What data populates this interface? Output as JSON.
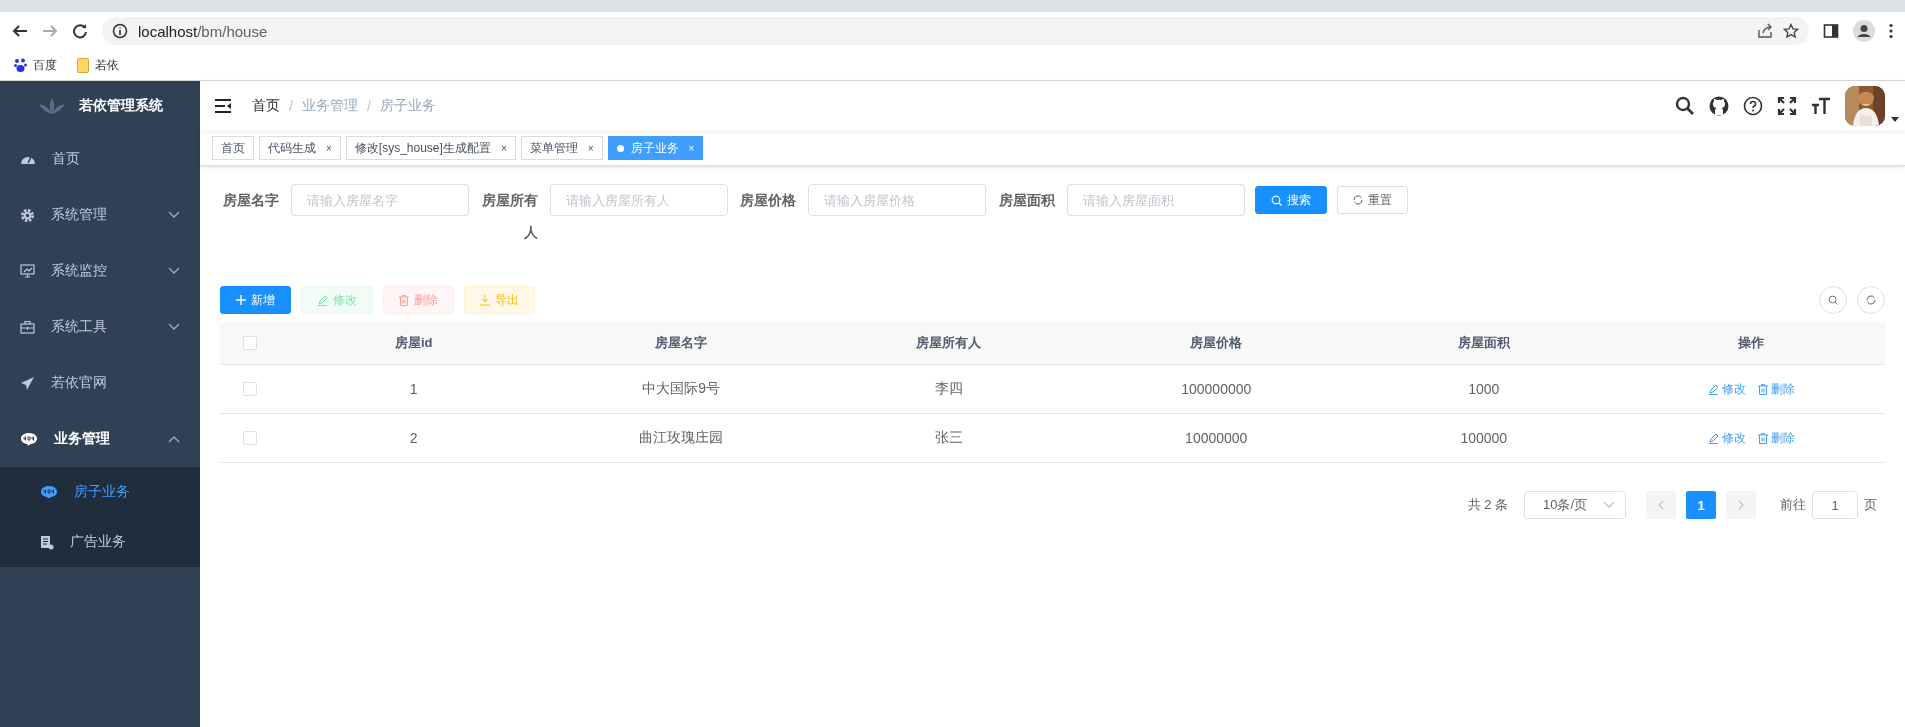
{
  "browser": {
    "url_host": "localhost",
    "url_path": "/bm/house",
    "bookmarks": [
      "百度",
      "若依"
    ]
  },
  "sidebar": {
    "title": "若依管理系统",
    "items": [
      {
        "label": "首页",
        "kind": "link"
      },
      {
        "label": "系统管理",
        "kind": "group",
        "expanded": false
      },
      {
        "label": "系统监控",
        "kind": "group",
        "expanded": false
      },
      {
        "label": "系统工具",
        "kind": "group",
        "expanded": false
      },
      {
        "label": "若依官网",
        "kind": "link"
      },
      {
        "label": "业务管理",
        "kind": "group",
        "expanded": true,
        "children": [
          {
            "label": "房子业务",
            "selected": true
          },
          {
            "label": "广告业务",
            "selected": false
          }
        ]
      }
    ]
  },
  "breadcrumb": {
    "items": [
      "首页",
      "业务管理",
      "房子业务"
    ],
    "separators": [
      "/",
      "/"
    ]
  },
  "tags": [
    {
      "label": "首页",
      "selected": false
    },
    {
      "label": "代码生成",
      "selected": false,
      "close": "×"
    },
    {
      "label": "修改[sys_house]生成配置",
      "selected": false,
      "close": "×"
    },
    {
      "label": "菜单管理",
      "selected": false,
      "close": "×"
    },
    {
      "label": "房子业务",
      "selected": true,
      "close": "×"
    }
  ],
  "search": {
    "fields": [
      {
        "label": "房屋名字",
        "placeholder": "请输入房屋名字"
      },
      {
        "label": "房屋所有人",
        "placeholder": "请输入房屋所有人"
      },
      {
        "label": "房屋价格",
        "placeholder": "请输入房屋价格"
      },
      {
        "label": "房屋面积",
        "placeholder": "请输入房屋面积"
      }
    ],
    "buttons": [
      {
        "label": "搜索",
        "kind": "primary"
      },
      {
        "label": "重置",
        "kind": "default"
      }
    ]
  },
  "toolbar": {
    "buttons": [
      {
        "label": "新增",
        "kind": "primary",
        "disabled": false
      },
      {
        "label": "修改",
        "kind": "success",
        "disabled": true
      },
      {
        "label": "删除",
        "kind": "danger",
        "disabled": true
      },
      {
        "label": "导出",
        "kind": "warning",
        "disabled": false
      }
    ]
  },
  "table": {
    "header_checked": false,
    "columns": [
      "房屋id",
      "房屋名字",
      "房屋所有人",
      "房屋价格",
      "房屋面积",
      "操作"
    ],
    "rows": [
      {
        "checked": false,
        "cells": [
          "1",
          "中大国际9号",
          "李四",
          "100000000",
          "1000"
        ],
        "actions": [
          "修改",
          "删除"
        ]
      },
      {
        "checked": false,
        "cells": [
          "2",
          "曲江玫瑰庄园",
          "张三",
          "10000000",
          "100000"
        ],
        "actions": [
          "修改",
          "删除"
        ]
      }
    ]
  },
  "pagination": {
    "total": "共 2 条",
    "page_size": "10条/页",
    "pages": [
      {
        "label": "1",
        "selected": true
      }
    ],
    "goto_label": "前往",
    "goto_value": "1",
    "goto_suffix": "页"
  }
}
